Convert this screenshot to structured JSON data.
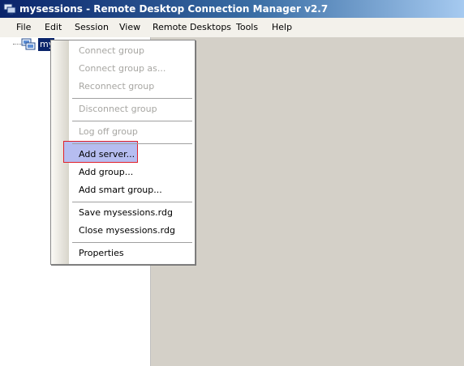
{
  "window": {
    "title": "mysessions - Remote Desktop Connection Manager v2.7"
  },
  "menubar": {
    "items": [
      "File",
      "Edit",
      "Session",
      "View",
      "Remote Desktops",
      "Tools",
      "Help"
    ]
  },
  "tree": {
    "root_label": "my",
    "root_icon": "server-group-icon"
  },
  "context_menu": {
    "items": [
      {
        "label": "Connect group",
        "enabled": false
      },
      {
        "label": "Connect group as...",
        "enabled": false
      },
      {
        "label": "Reconnect group",
        "enabled": false
      },
      {
        "label": "Disconnect group",
        "enabled": false
      },
      {
        "label": "Log off group",
        "enabled": false
      },
      {
        "label": "Add server...",
        "enabled": true,
        "highlighted": true
      },
      {
        "label": "Add group...",
        "enabled": true
      },
      {
        "label": "Add smart group...",
        "enabled": true
      },
      {
        "label": "Save mysessions.rdg",
        "enabled": true
      },
      {
        "label": "Close mysessions.rdg",
        "enabled": true
      },
      {
        "label": "Properties",
        "enabled": true
      }
    ]
  },
  "colors": {
    "titlebar_start": "#0a246a",
    "titlebar_end": "#a6caf0",
    "highlight_fill": "#b6bdf0",
    "highlight_border": "#e0202a",
    "disabled_text": "#a7a6a2"
  }
}
